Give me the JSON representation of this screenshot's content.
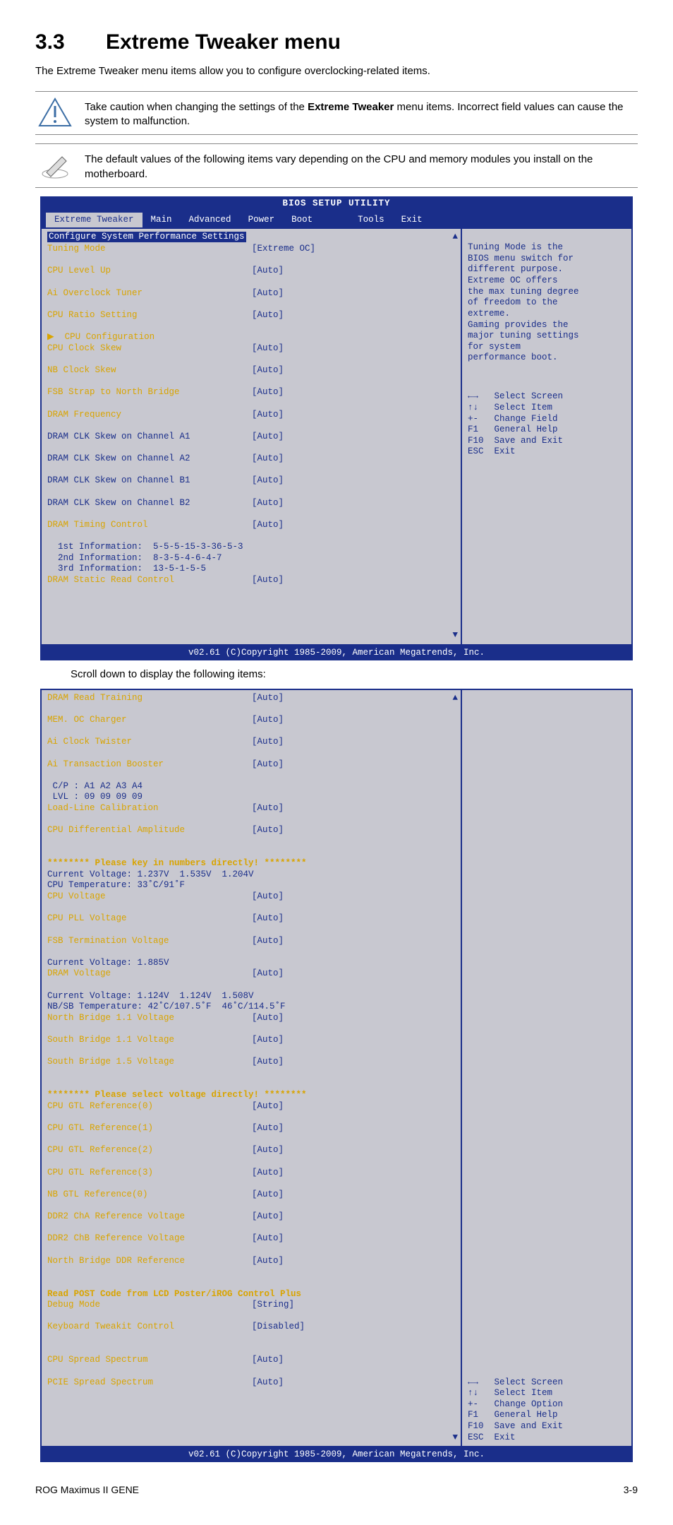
{
  "section_number": "3.3",
  "section_title": "Extreme Tweaker menu",
  "intro": "The Extreme Tweaker menu items allow you to configure overclocking-related items.",
  "note_caution": "Take caution when changing the settings of the Extreme Tweaker menu items. Incorrect field values can cause the system to malfunction.",
  "note_caution_bold": "Extreme Tweaker",
  "note_info": "The default values of the following items vary depending on the CPU and memory modules you install on the motherboard.",
  "bios_header": "BIOS SETUP UTILITY",
  "tabs": {
    "active": "Extreme Tweaker",
    "items": [
      "Main",
      "Advanced",
      "Power",
      "Boot",
      "Tools",
      "Exit"
    ]
  },
  "panel1": {
    "header": "Configure System Performance Settings",
    "rows": [
      {
        "l": "Tuning Mode",
        "v": "[Extreme OC]",
        "yl": true
      },
      {
        "l": "CPU Level Up",
        "v": "[Auto]",
        "yl": true
      },
      {
        "l": "Ai Overclock Tuner",
        "v": "[Auto]",
        "yl": true
      },
      {
        "l": "CPU Ratio Setting",
        "v": "[Auto]",
        "yl": true
      },
      {
        "l": "▶  CPU Configuration",
        "v": "",
        "yl": true,
        "noval": true
      },
      {
        "l": "CPU Clock Skew",
        "v": "[Auto]",
        "yl": true
      },
      {
        "l": "NB Clock Skew",
        "v": "[Auto]",
        "yl": true
      },
      {
        "l": "FSB Strap to North Bridge",
        "v": "[Auto]",
        "yl": true
      },
      {
        "l": "DRAM Frequency",
        "v": "[Auto]",
        "yl": true
      },
      {
        "l": "DRAM CLK Skew on Channel A1",
        "v": "[Auto]"
      },
      {
        "l": "DRAM CLK Skew on Channel A2",
        "v": "[Auto]"
      },
      {
        "l": "DRAM CLK Skew on Channel B1",
        "v": "[Auto]"
      },
      {
        "l": "DRAM CLK Skew on Channel B2",
        "v": "[Auto]"
      },
      {
        "l": "DRAM Timing Control",
        "v": "[Auto]",
        "yl": true
      },
      {
        "l": "  1st Information:  5-5-5-15-3-36-5-3",
        "v": "",
        "noval": true
      },
      {
        "l": "  2nd Information:  8-3-5-4-6-4-7",
        "v": "",
        "noval": true
      },
      {
        "l": "  3rd Information:  13-5-1-5-5",
        "v": "",
        "noval": true
      },
      {
        "l": "DRAM Static Read Control",
        "v": "[Auto]",
        "yl": true
      }
    ],
    "help": "Tuning Mode is the\nBIOS menu switch for\ndifferent purpose.\nExtreme OC offers\nthe max tuning degree\nof freedom to the\nextreme.\nGaming provides the\nmajor tuning settings\nfor system\nperformance boot.",
    "nav": "←→   Select Screen\n↑↓   Select Item\n+-   Change Field\nF1   General Help\nF10  Save and Exit\nESC  Exit"
  },
  "copyright": "v02.61 (C)Copyright 1985-2009, American Megatrends, Inc.",
  "scroll_note": "Scroll down to display the following items:",
  "panel2": {
    "rows": [
      {
        "l": "DRAM Read Training",
        "v": "[Auto]",
        "yl": true
      },
      {
        "l": "MEM. OC Charger",
        "v": "[Auto]",
        "yl": true
      },
      {
        "l": "Ai Clock Twister",
        "v": "[Auto]",
        "yl": true
      },
      {
        "l": "Ai Transaction Booster",
        "v": "[Auto]",
        "yl": true
      },
      {
        "l": " C/P : A1 A2 A3 A4",
        "v": "",
        "noval": true
      },
      {
        "l": " LVL : 09 09 09 09",
        "v": "",
        "noval": true
      },
      {
        "l": "Load-Line Calibration",
        "v": "[Auto]",
        "yl": true
      },
      {
        "l": "CPU Differential Amplitude",
        "v": "[Auto]",
        "yl": true
      },
      {
        "l": "",
        "v": "",
        "noval": true,
        "blank": true
      },
      {
        "l": "******** Please key in numbers directly! ********",
        "v": "",
        "noval": true,
        "yl": true,
        "bold": true
      },
      {
        "l": "Current Voltage: 1.237V  1.535V  1.204V",
        "v": "",
        "noval": true
      },
      {
        "l": "CPU Temperature: 33˚C/91˚F",
        "v": "",
        "noval": true
      },
      {
        "l": "CPU Voltage",
        "v": "[Auto]",
        "yl": true
      },
      {
        "l": "CPU PLL Voltage",
        "v": "[Auto]",
        "yl": true
      },
      {
        "l": "FSB Termination Voltage",
        "v": "[Auto]",
        "yl": true
      },
      {
        "l": "Current Voltage: 1.885V",
        "v": "",
        "noval": true
      },
      {
        "l": "DRAM Voltage",
        "v": "[Auto]",
        "yl": true
      },
      {
        "l": "Current Voltage: 1.124V  1.124V  1.508V",
        "v": "",
        "noval": true
      },
      {
        "l": "NB/SB Temperature: 42˚C/107.5˚F  46˚C/114.5˚F",
        "v": "",
        "noval": true
      },
      {
        "l": "North Bridge 1.1 Voltage",
        "v": "[Auto]",
        "yl": true
      },
      {
        "l": "South Bridge 1.1 Voltage",
        "v": "[Auto]",
        "yl": true
      },
      {
        "l": "South Bridge 1.5 Voltage",
        "v": "[Auto]",
        "yl": true
      },
      {
        "l": "",
        "v": "",
        "noval": true,
        "blank": true
      },
      {
        "l": "******** Please select voltage directly! ********",
        "v": "",
        "noval": true,
        "yl": true,
        "bold": true
      },
      {
        "l": "CPU GTL Reference(0)",
        "v": "[Auto]",
        "yl": true
      },
      {
        "l": "CPU GTL Reference(1)",
        "v": "[Auto]",
        "yl": true
      },
      {
        "l": "CPU GTL Reference(2)",
        "v": "[Auto]",
        "yl": true
      },
      {
        "l": "CPU GTL Reference(3)",
        "v": "[Auto]",
        "yl": true
      },
      {
        "l": "NB GTL Reference(0)",
        "v": "[Auto]",
        "yl": true
      },
      {
        "l": "DDR2 ChA Reference Voltage",
        "v": "[Auto]",
        "yl": true
      },
      {
        "l": "DDR2 ChB Reference Voltage",
        "v": "[Auto]",
        "yl": true
      },
      {
        "l": "North Bridge DDR Reference",
        "v": "[Auto]",
        "yl": true
      },
      {
        "l": "",
        "v": "",
        "noval": true,
        "blank": true
      },
      {
        "l": "Read POST Code from LCD Poster/iROG Control Plus",
        "v": "",
        "noval": true,
        "yl": true,
        "bold": true
      },
      {
        "l": "Debug Mode",
        "v": "[String]",
        "yl": true
      },
      {
        "l": "Keyboard Tweakit Control",
        "v": "[Disabled]",
        "yl": true
      },
      {
        "l": "",
        "v": "",
        "noval": true,
        "blank": true
      },
      {
        "l": "CPU Spread Spectrum",
        "v": "[Auto]",
        "yl": true
      },
      {
        "l": "PCIE Spread Spectrum",
        "v": "[Auto]",
        "yl": true
      }
    ],
    "nav": "←→   Select Screen\n↑↓   Select Item\n+-   Change Option\nF1   General Help\nF10  Save and Exit\nESC  Exit"
  },
  "footer_left": "ROG Maximus II GENE",
  "footer_right": "3-9"
}
